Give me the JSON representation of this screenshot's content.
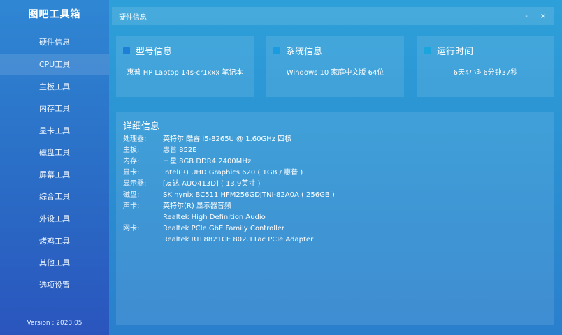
{
  "app_title": "图吧工具箱",
  "version": "Version : 2023.05",
  "sidebar": {
    "items": [
      {
        "label": "硬件信息"
      },
      {
        "label": "CPU工具"
      },
      {
        "label": "主板工具"
      },
      {
        "label": "内存工具"
      },
      {
        "label": "显卡工具"
      },
      {
        "label": "磁盘工具"
      },
      {
        "label": "屏幕工具"
      },
      {
        "label": "综合工具"
      },
      {
        "label": "外设工具"
      },
      {
        "label": "烤鸡工具"
      },
      {
        "label": "其他工具"
      },
      {
        "label": "选项设置"
      }
    ],
    "active_index": 1
  },
  "window": {
    "title": "硬件信息",
    "minimize": "-",
    "close": "×"
  },
  "cards": {
    "model": {
      "title": "型号信息",
      "value": "惠普 HP Laptop 14s-cr1xxx 笔记本",
      "icon_color": "#1e7fd6",
      "icon": "model-square-icon"
    },
    "system": {
      "title": "系统信息",
      "value": "Windows 10 家庭中文版 64位",
      "icon_color": "#1b9be0",
      "icon": "windows-square-icon"
    },
    "uptime": {
      "title": "运行时间",
      "value": "6天4小时6分钟37秒",
      "icon_color": "#1aa6dc",
      "icon": "clock-square-icon"
    }
  },
  "detail": {
    "title": "详细信息",
    "rows": [
      {
        "label": "处理器:",
        "value": "英特尔 酷睿 i5-8265U @ 1.60GHz 四核"
      },
      {
        "label": "主板:",
        "value": "惠普 852E"
      },
      {
        "label": "内存:",
        "value": "三星 8GB DDR4 2400MHz"
      },
      {
        "label": "显卡:",
        "value": "Intel(R) UHD Graphics 620 ( 1GB / 惠普 )"
      },
      {
        "label": "显示器:",
        "value": "[友达 AUO413D] ( 13.9英寸 )"
      },
      {
        "label": "磁盘:",
        "value": "SK hynix BC511 HFM256GDJTNI-82A0A ( 256GB )"
      },
      {
        "label": "声卡:",
        "value": "英特尔(R) 显示器音频"
      },
      {
        "label": "",
        "value": "Realtek High Definition Audio"
      },
      {
        "label": "网卡:",
        "value": "Realtek PCIe GbE Family Controller"
      },
      {
        "label": "",
        "value": "Realtek RTL8821CE 802.11ac PCIe Adapter"
      }
    ]
  }
}
